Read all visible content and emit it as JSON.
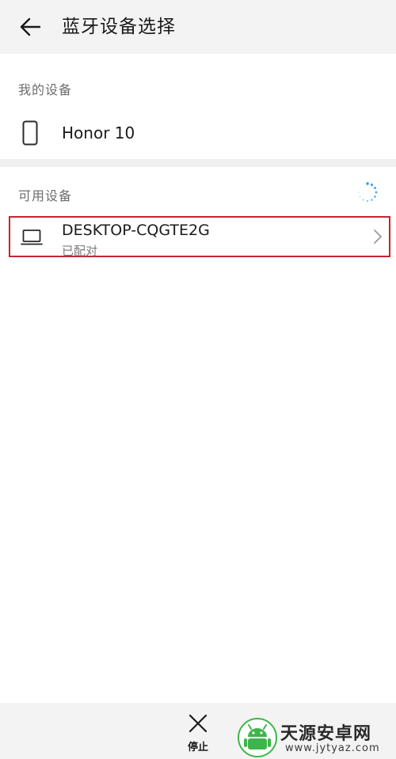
{
  "header": {
    "title": "蓝牙设备选择",
    "back_icon": "arrow-left-icon"
  },
  "my_devices": {
    "label": "我的设备",
    "items": [
      {
        "name": "Honor 10",
        "icon": "phone-icon"
      }
    ]
  },
  "available_devices": {
    "label": "可用设备",
    "scanning_icon": "loading-spinner-icon",
    "items": [
      {
        "name": "DESKTOP-CQGTE2G",
        "status": "已配对",
        "icon": "laptop-icon",
        "highlight_color": "#c8242f"
      }
    ]
  },
  "bottom_bar": {
    "stop_label": "停止",
    "stop_icon": "close-icon"
  },
  "watermark": {
    "text": "天源安卓网",
    "url": "www.jytyaz.com",
    "logo_color": "#3db54a"
  }
}
